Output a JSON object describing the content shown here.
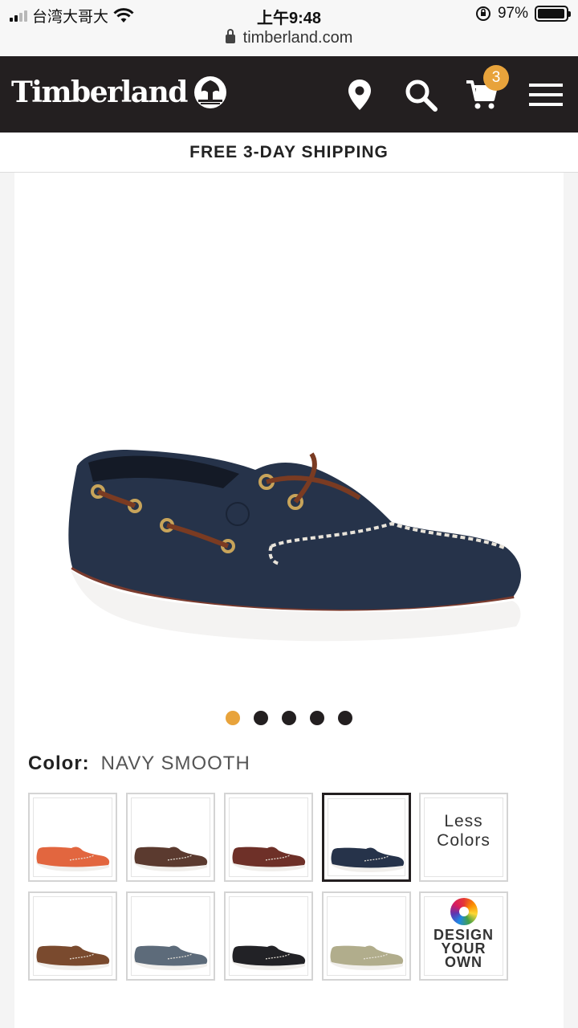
{
  "status_bar": {
    "carrier": "台湾大哥大",
    "time": "上午9:48",
    "battery": "97%",
    "battery_level": 0.97
  },
  "url_bar": {
    "url": "timberland.com"
  },
  "header": {
    "brand": "Timberland",
    "cart_count": "3",
    "icons": [
      "location-icon",
      "search-icon",
      "cart-icon",
      "menu-icon"
    ]
  },
  "promo": {
    "text": "FREE 3-DAY SHIPPING"
  },
  "product": {
    "color_label": "Color:",
    "color_value": "NAVY SMOOTH",
    "carousel": {
      "total": 5,
      "active": 1
    },
    "swatches_row1": [
      {
        "name": "orange",
        "color": "#e2663f",
        "selected": false
      },
      {
        "name": "dark-brown",
        "color": "#5b3a2f",
        "selected": false
      },
      {
        "name": "burgundy",
        "color": "#6e3028",
        "selected": false
      },
      {
        "name": "navy-smooth",
        "color": "#26334a",
        "selected": true
      }
    ],
    "less_colors_label": "Less Colors",
    "swatches_row2": [
      {
        "name": "brown",
        "color": "#7a4a2e",
        "selected": false
      },
      {
        "name": "gray-blue",
        "color": "#5d6b7a",
        "selected": false
      },
      {
        "name": "black",
        "color": "#222226",
        "selected": false
      },
      {
        "name": "sage",
        "color": "#b1ad8c",
        "selected": false
      }
    ],
    "design_your_own_label": [
      "DESIGN",
      "YOUR",
      "OWN"
    ]
  },
  "colors": {
    "header_bg": "#231f20",
    "accent": "#e8a33b",
    "hero_shoe": "#26334a"
  }
}
